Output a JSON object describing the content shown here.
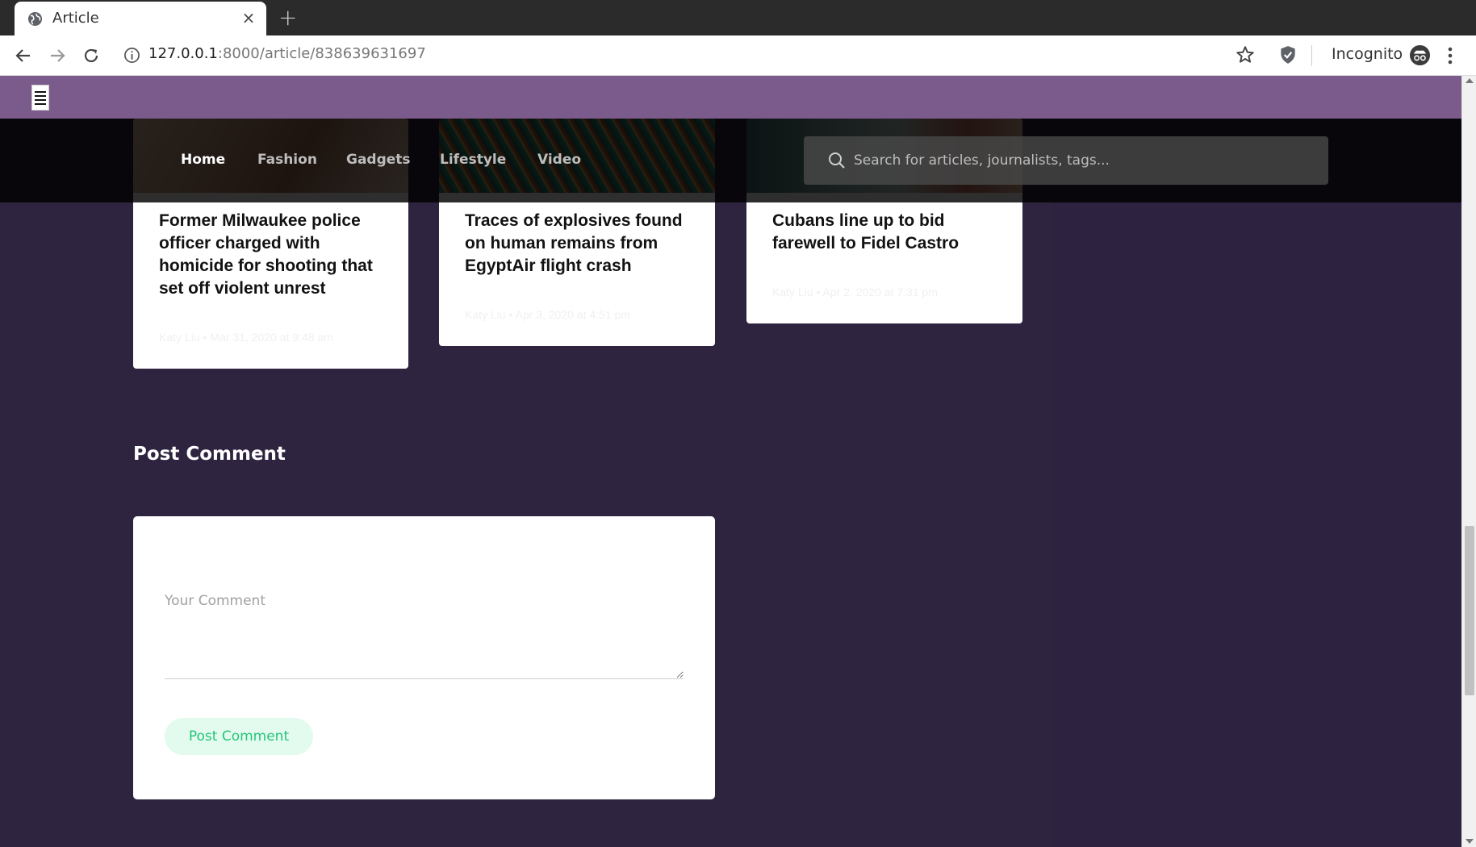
{
  "browser": {
    "tab_title": "Article",
    "tab_close": "×",
    "new_tab": "+",
    "url_host": "127.0.0.1",
    "url_rest": ":8000/article/838639631697",
    "incognito_label": "Incognito"
  },
  "nav": {
    "items": [
      "Home",
      "Fashion",
      "Gadgets",
      "Lifestyle",
      "Video"
    ],
    "active": "Home",
    "search_placeholder": "Search for articles, journalists, tags..."
  },
  "cards": [
    {
      "title": "Former Milwaukee police officer charged with homicide for shooting that set off violent unrest",
      "author": "Katy Liu",
      "date": "Mar 31, 2020 at 9:48 am"
    },
    {
      "title": "Traces of explosives found on human remains from EgyptAir flight crash",
      "author": "Katy Liu",
      "date": "Apr 3, 2020 at 4:51 pm"
    },
    {
      "title": "Cubans line up to bid farewell to Fidel Castro",
      "author": "Katy Liu",
      "date": "Apr 2, 2020 at 7:31 pm"
    }
  ],
  "comment": {
    "section_title": "Post Comment",
    "placeholder": "Your Comment",
    "button_label": "Post Comment"
  },
  "colors": {
    "page_bg": "#2e2440",
    "top_bar": "#7b5a8c",
    "button_bg": "#e3fbef",
    "button_text": "#27c47a"
  }
}
